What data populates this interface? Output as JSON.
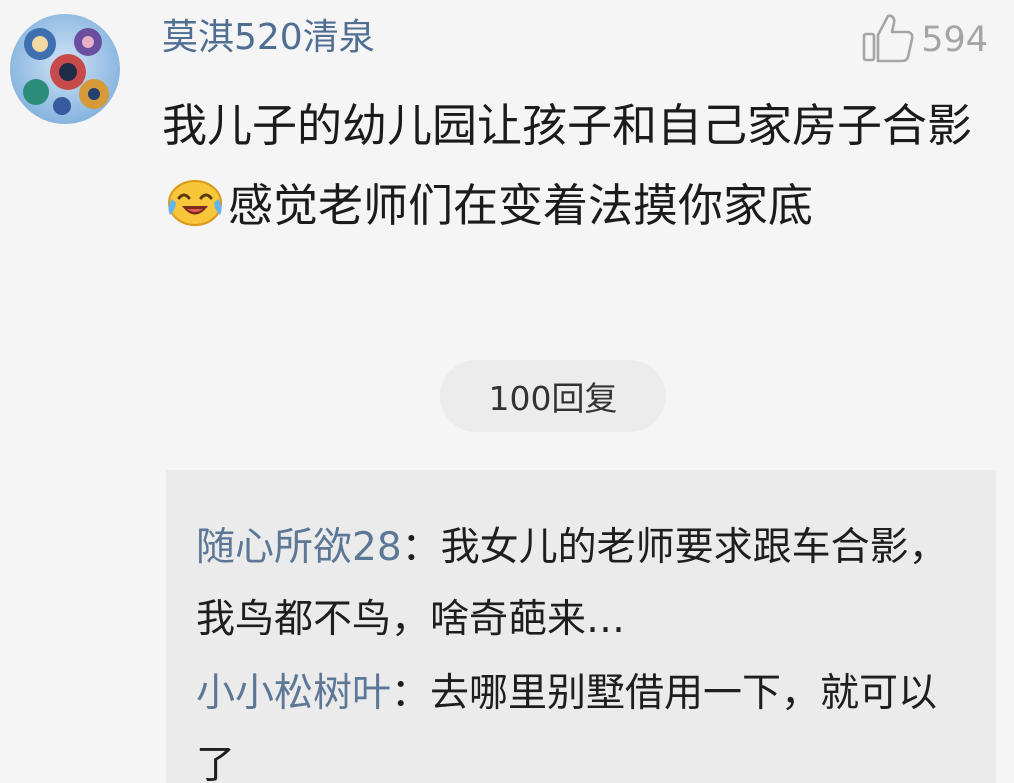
{
  "comment": {
    "username": "莫淇520清泉",
    "like_count": "594",
    "text_part1": "我儿子的幼儿园让孩子和自己家房子合影",
    "emoji": "laugh-cry-emoji",
    "text_part2": "感觉老师们在变着法摸你家底"
  },
  "reply_button": {
    "label": "100回复"
  },
  "replies": [
    {
      "author": "随心所欲28",
      "separator": "：",
      "text": "我女儿的老师要求跟车合影，我鸟都不鸟，啥奇葩来…"
    },
    {
      "author": "小小松树叶",
      "separator": "：",
      "text": "去哪里别墅借用一下，就可以了"
    }
  ],
  "icons": {
    "like": "thumbs-up-icon",
    "avatar": "user-avatar"
  },
  "colors": {
    "username": "#4e6e92",
    "reply_author": "#5d7796",
    "body_text": "#1b1b1b",
    "muted": "#a5a5a5",
    "background": "#f5f5f5",
    "reply_panel": "#ebebeb"
  }
}
